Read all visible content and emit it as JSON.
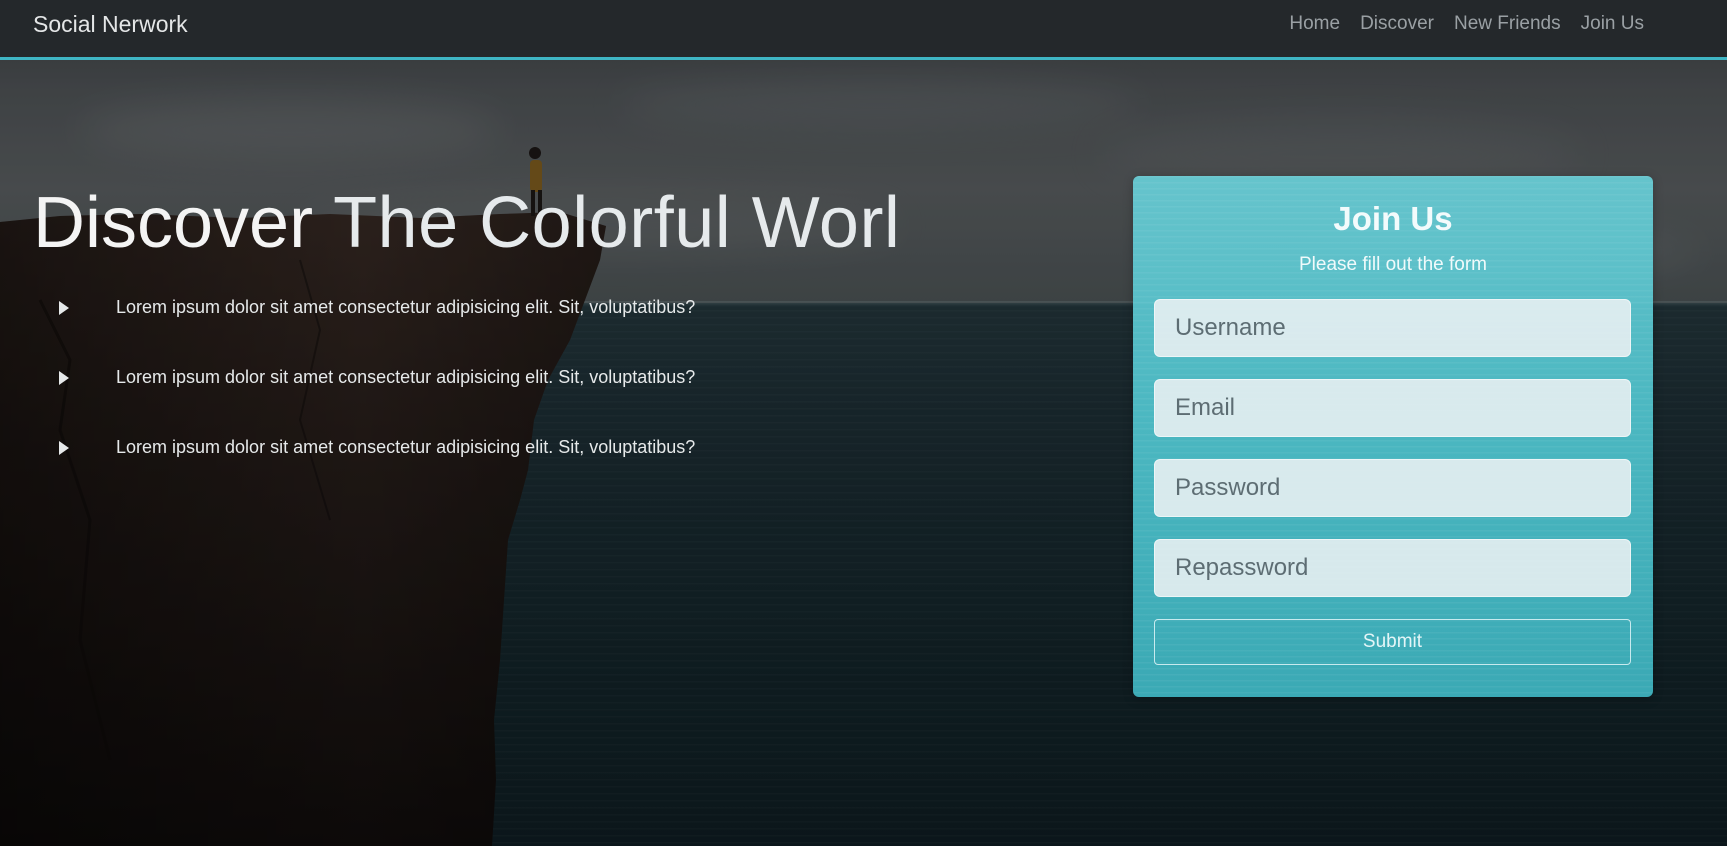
{
  "navbar": {
    "brand": "Social Nerwork",
    "links": [
      "Home",
      "Discover",
      "New Friends",
      "Join Us"
    ]
  },
  "hero": {
    "title_bold": "Discover",
    "title_light": "The Colorful Worl",
    "bullets": [
      "Lorem ipsum dolor sit amet consectetur adipisicing elit. Sit, voluptatibus?",
      "Lorem ipsum dolor sit amet consectetur adipisicing elit. Sit, voluptatibus?",
      "Lorem ipsum dolor sit amet consectetur adipisicing elit. Sit, voluptatibus?"
    ]
  },
  "form": {
    "title": "Join Us",
    "subtitle": "Please fill out the form",
    "username_placeholder": "Username",
    "email_placeholder": "Email",
    "password_placeholder": "Password",
    "repassword_placeholder": "Repassword",
    "submit_label": "Submit"
  },
  "colors": {
    "navbar_bg": "#24282b",
    "accent": "#3fb5c4",
    "card": "#50c3cd"
  }
}
